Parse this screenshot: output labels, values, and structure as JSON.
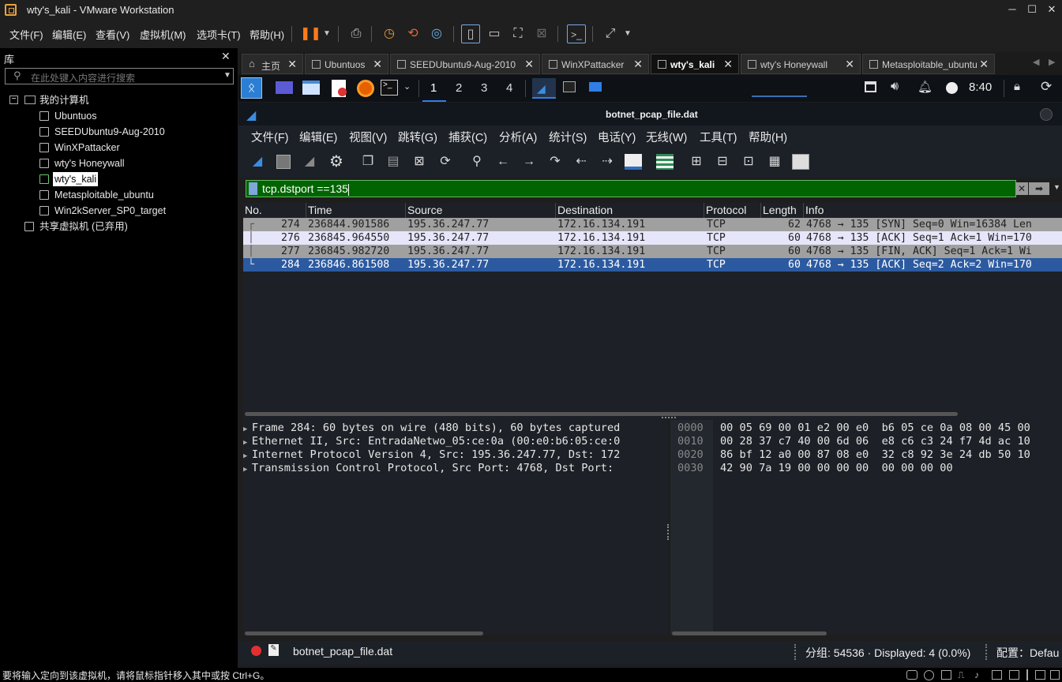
{
  "window": {
    "title": "wty's_kali - VMware Workstation"
  },
  "vm_menu": [
    "文件(F)",
    "编辑(E)",
    "查看(V)",
    "虚拟机(M)",
    "选项卡(T)",
    "帮助(H)"
  ],
  "library": {
    "header": "库",
    "search_placeholder": "在此处键入内容进行搜索",
    "root": "我的计算机",
    "vms": [
      "Ubuntuos",
      "SEEDUbuntu9-Aug-2010",
      "WinXPattacker",
      "wty's Honeywall",
      "wty's_kali",
      "Metasploitable_ubuntu",
      "Win2kServer_SP0_target"
    ],
    "selected_vm": "wty's_kali",
    "shared": "共享虚拟机 (已弃用)"
  },
  "vm_tabs": [
    {
      "label": "主页",
      "active": false
    },
    {
      "label": "Ubuntuos",
      "active": false
    },
    {
      "label": "SEEDUbuntu9-Aug-2010",
      "active": false
    },
    {
      "label": "WinXPattacker",
      "active": false
    },
    {
      "label": "wty's_kali",
      "active": true
    },
    {
      "label": "wty's Honeywall",
      "active": false
    },
    {
      "label": "Metasploitable_ubuntu",
      "active": false
    }
  ],
  "kali_panel": {
    "workspaces": [
      "1",
      "2",
      "3",
      "4"
    ],
    "active_workspace": "1",
    "clock": "8:40"
  },
  "wireshark": {
    "title": "botnet_pcap_file.dat",
    "menu": [
      "文件(F)",
      "编辑(E)",
      "视图(V)",
      "跳转(G)",
      "捕获(C)",
      "分析(A)",
      "统计(S)",
      "电话(Y)",
      "无线(W)",
      "工具(T)",
      "帮助(H)"
    ],
    "filter": "tcp.dstport ==135",
    "columns": [
      "No.",
      "Time",
      "Source",
      "Destination",
      "Protocol",
      "Length",
      "Info"
    ],
    "packets": [
      {
        "no": "274",
        "time": "236844.901586",
        "source": "195.36.247.77",
        "destination": "172.16.134.191",
        "protocol": "TCP",
        "length": "62",
        "info": "4768 → 135 [SYN] Seq=0 Win=16384 Len"
      },
      {
        "no": "276",
        "time": "236845.964550",
        "source": "195.36.247.77",
        "destination": "172.16.134.191",
        "protocol": "TCP",
        "length": "60",
        "info": "4768 → 135 [ACK] Seq=1 Ack=1 Win=170"
      },
      {
        "no": "277",
        "time": "236845.982720",
        "source": "195.36.247.77",
        "destination": "172.16.134.191",
        "protocol": "TCP",
        "length": "60",
        "info": "4768 → 135 [FIN, ACK] Seq=1 Ack=1 Wi"
      },
      {
        "no": "284",
        "time": "236846.861508",
        "source": "195.36.247.77",
        "destination": "172.16.134.191",
        "protocol": "TCP",
        "length": "60",
        "info": "4768 → 135 [ACK] Seq=2 Ack=2 Win=170"
      }
    ],
    "selected_packet": "284",
    "details": [
      "Frame 284: 60 bytes on wire (480 bits), 60 bytes captured",
      "Ethernet II, Src: EntradaNetwo_05:ce:0a (00:e0:b6:05:ce:0",
      "Internet Protocol Version 4, Src: 195.36.247.77, Dst: 172",
      "Transmission Control Protocol, Src Port: 4768, Dst Port:"
    ],
    "bytes": [
      {
        "offset": "0000",
        "hex": "00 05 69 00 01 e2 00 e0  b6 05 ce 0a 08 00 45 00"
      },
      {
        "offset": "0010",
        "hex": "00 28 37 c7 40 00 6d 06  e8 c6 c3 24 f7 4d ac 10"
      },
      {
        "offset": "0020",
        "hex": "86 bf 12 a0 00 87 08 e0  32 c8 92 3e 24 db 50 10"
      },
      {
        "offset": "0030",
        "hex": "42 90 7a 19 00 00 00 00  00 00 00 00"
      }
    ],
    "status": {
      "file": "botnet_pcap_file.dat",
      "counts": "分组: 54536 · Displayed: 4 (0.0%)",
      "profile": "配置：Defau"
    }
  },
  "vm_status": "要将输入定向到该虚拟机，请将鼠标指针移入其中或按 Ctrl+G。",
  "colors": {
    "filter_ok": "#006400",
    "selected_row": "#2c5aa0",
    "syn_row": "#a0a0a0",
    "ack_row": "#e6e6fa"
  }
}
